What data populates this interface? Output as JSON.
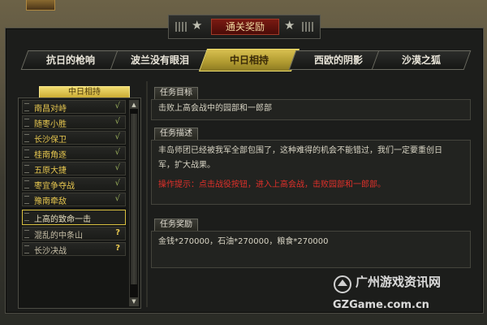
{
  "window": {
    "title": "通关奖励"
  },
  "tabs": [
    {
      "label": "抗日的枪响",
      "active": false
    },
    {
      "label": "波兰没有眼泪",
      "active": false
    },
    {
      "label": "中日相持",
      "active": true
    },
    {
      "label": "西欧的阴影",
      "active": false
    },
    {
      "label": "沙漠之狐",
      "active": false
    }
  ],
  "chapter": {
    "title": "中日相持"
  },
  "missions": [
    {
      "name": "南昌对峙",
      "status": "√"
    },
    {
      "name": "随枣小胜",
      "status": "√"
    },
    {
      "name": "长沙保卫",
      "status": "√"
    },
    {
      "name": "桂南角逐",
      "status": "√"
    },
    {
      "name": "五原大捷",
      "status": "√"
    },
    {
      "name": "枣宜争夺战",
      "status": "√"
    },
    {
      "name": "豫南牵敌",
      "status": "√"
    },
    {
      "name": "上高的致命一击",
      "status": ""
    },
    {
      "name": "混乱的中条山",
      "status": "?"
    },
    {
      "name": "长沙决战",
      "status": "?"
    }
  ],
  "scrollbar": {
    "up": "▲",
    "down": "▼"
  },
  "goal": {
    "label": "任务目标",
    "text": "击败上高会战中的园部和一郎部"
  },
  "desc": {
    "label": "任务描述",
    "line1": "丰岛师团已经被我军全部包围了，这种难得的机会不能错过，我们一定要重创日",
    "line2": "军，扩大战果。",
    "hint": "操作提示：点击战役按钮，进入上高会战，击败园部和一郎部。"
  },
  "reward": {
    "label": "任务奖励",
    "text": "金钱*270000，石油*270000，粮食*270000"
  },
  "watermark": {
    "line1": "广州游戏资讯网",
    "line2": "GZGame.com.cn"
  },
  "colors": {
    "accent_gold": "#d8c050",
    "hint_red": "#e0302a",
    "done_green": "#9ab05c"
  }
}
